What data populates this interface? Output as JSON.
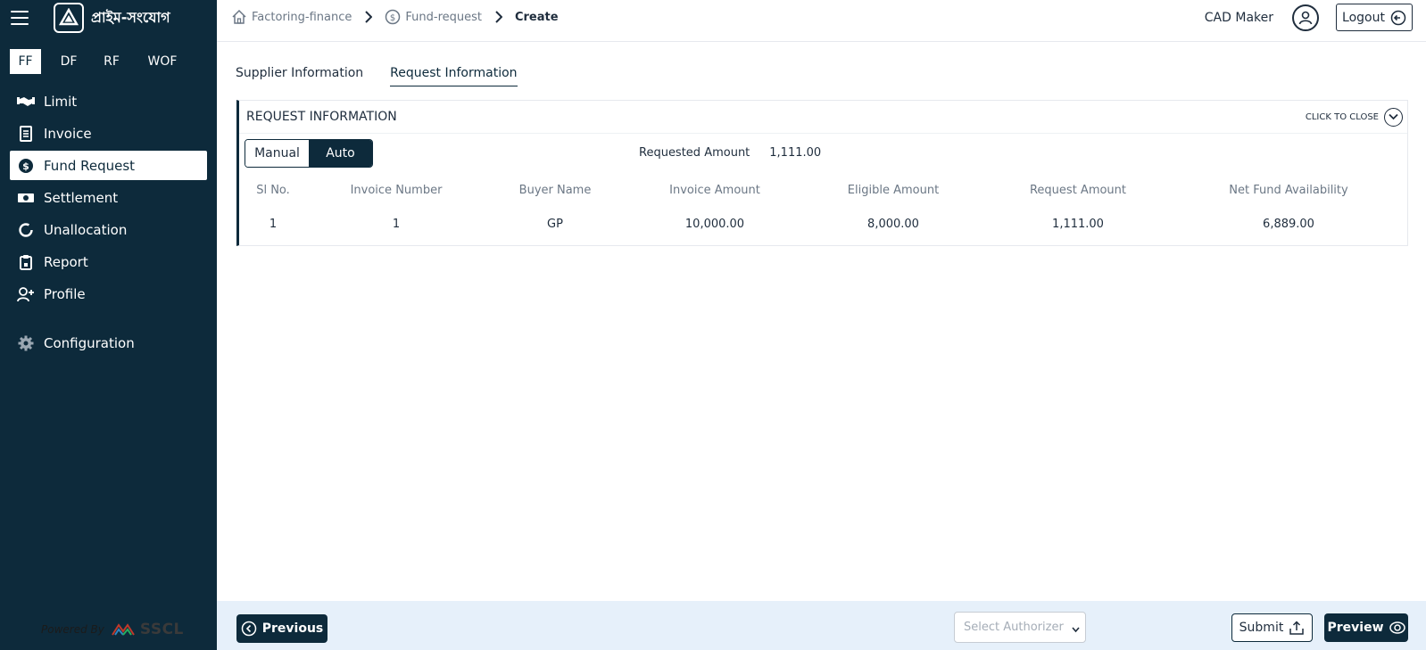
{
  "brand": {
    "name": "প্রাইম-সংযোগ"
  },
  "type_tabs": [
    "FF",
    "DF",
    "RF",
    "WOF"
  ],
  "nav": [
    {
      "label": "Limit",
      "icon": "handshake-icon"
    },
    {
      "label": "Invoice",
      "icon": "document-icon"
    },
    {
      "label": "Fund Request",
      "icon": "dollar-circle-icon"
    },
    {
      "label": "Settlement",
      "icon": "cash-icon"
    },
    {
      "label": "Unallocation",
      "icon": "refresh-icon"
    },
    {
      "label": "Report",
      "icon": "clipboard-icon"
    },
    {
      "label": "Profile",
      "icon": "user-plus-icon"
    },
    {
      "label": "Configuration",
      "icon": "gear-icon"
    }
  ],
  "powered_by": {
    "label": "Powered By",
    "company": "SSCL"
  },
  "breadcrumb": {
    "home": "Factoring-finance",
    "section": "Fund-request",
    "current": "Create"
  },
  "user": {
    "name": "CAD Maker",
    "logout": "Logout"
  },
  "tabs": [
    "Supplier Information",
    "Request Information"
  ],
  "panel": {
    "title": "REQUEST INFORMATION",
    "close_label": "CLICK TO CLOSE",
    "mode": {
      "manual": "Manual",
      "auto": "Auto",
      "selected": "Auto"
    },
    "requested_amount": {
      "label": "Requested Amount",
      "value": "1,111.00"
    }
  },
  "table": {
    "headers": [
      "Sl No.",
      "Invoice Number",
      "Buyer Name",
      "Invoice Amount",
      "Eligible Amount",
      "Request Amount",
      "Net Fund Availability"
    ],
    "rows": [
      [
        "1",
        "1",
        "GP",
        "10,000.00",
        "8,000.00",
        "1,111.00",
        "6,889.00"
      ]
    ]
  },
  "footer": {
    "previous": "Previous",
    "authorizer_placeholder": "Select Authorizer",
    "submit": "Submit",
    "preview": "Preview"
  },
  "colors": {
    "primary": "#0d2a3b",
    "footer_bg": "#e6f0fa"
  }
}
